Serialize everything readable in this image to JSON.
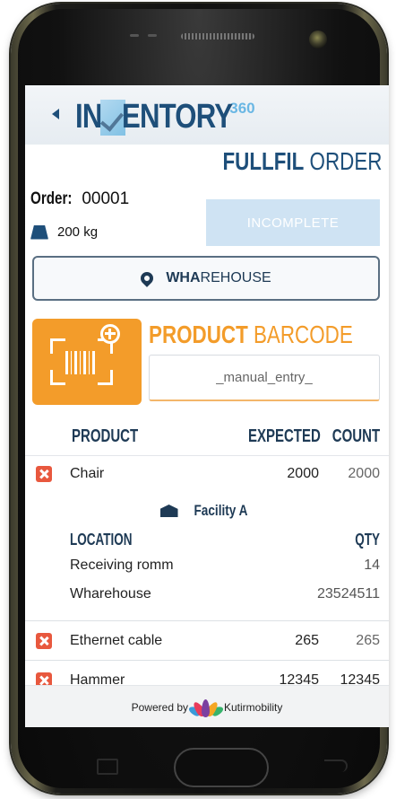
{
  "app": {
    "logo_text_in": "IN",
    "logo_text_rest": "ENTORY",
    "logo_suffix": "360",
    "page_title_bold": "FULLFIL",
    "page_title_rest": " ORDER"
  },
  "order": {
    "label": "Order:",
    "number": "00001",
    "weight": "200 kg",
    "status": "INCOMPLETE"
  },
  "location": {
    "bold": "WHA",
    "rest": "REHOUSE"
  },
  "barcode": {
    "title_bold": "PRODUCT",
    "title_rest": " BARCODE",
    "placeholder": "_manual_entry_"
  },
  "table": {
    "headers": {
      "product": "PRODUCT",
      "expected": "EXPECTED",
      "count": "COUNT"
    },
    "rows": [
      {
        "name": "Chair",
        "expected": "2000",
        "count": "2000"
      },
      {
        "name": "Ethernet cable",
        "expected": "265",
        "count": "265"
      },
      {
        "name": "Hammer",
        "expected": "12345",
        "count": "12345"
      }
    ],
    "facility": {
      "name": "Facility A",
      "location_header": "LOCATION",
      "qty_header": "QTY",
      "locations": [
        {
          "name": "Receiving romm",
          "qty": "14"
        },
        {
          "name": "Wharehouse",
          "qty": "23524511"
        }
      ]
    }
  },
  "footer": {
    "powered_by": "Powered by",
    "brand": "Kutirmobility"
  },
  "colors": {
    "primary": "#1e4f7a",
    "accent": "#f39c2a",
    "status_disabled": "#cfe3f3",
    "error": "#e8583e"
  }
}
